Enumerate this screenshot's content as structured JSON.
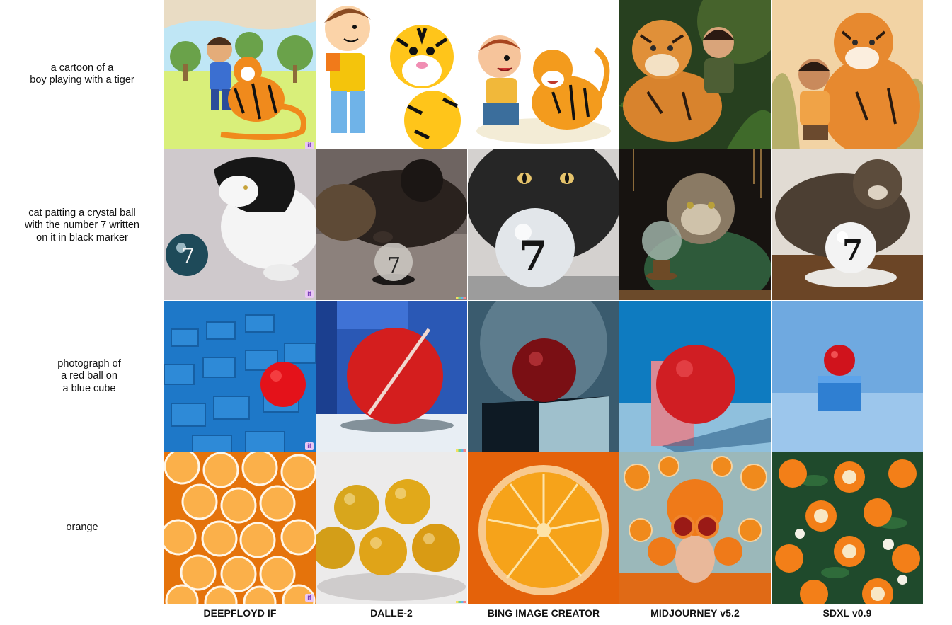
{
  "prompts": [
    {
      "lines": [
        "a cartoon of a",
        "boy playing with a tiger"
      ]
    },
    {
      "lines": [
        "cat patting a crystal ball",
        "with the number 7 written",
        "on it in black marker"
      ]
    },
    {
      "lines": [
        "photograph of",
        "a red ball on",
        "a blue cube"
      ]
    },
    {
      "lines": [
        "orange"
      ]
    }
  ],
  "models": [
    "DEEPFLOYD IF",
    "DALLE-2",
    "BING IMAGE CREATOR",
    "MIDJOURNEY v5.2",
    "SDXL v0.9"
  ],
  "watermarks": {
    "deepfloyd": "if"
  },
  "ball_number": "7",
  "colors": {
    "text": "#111111",
    "background": "#ffffff"
  }
}
